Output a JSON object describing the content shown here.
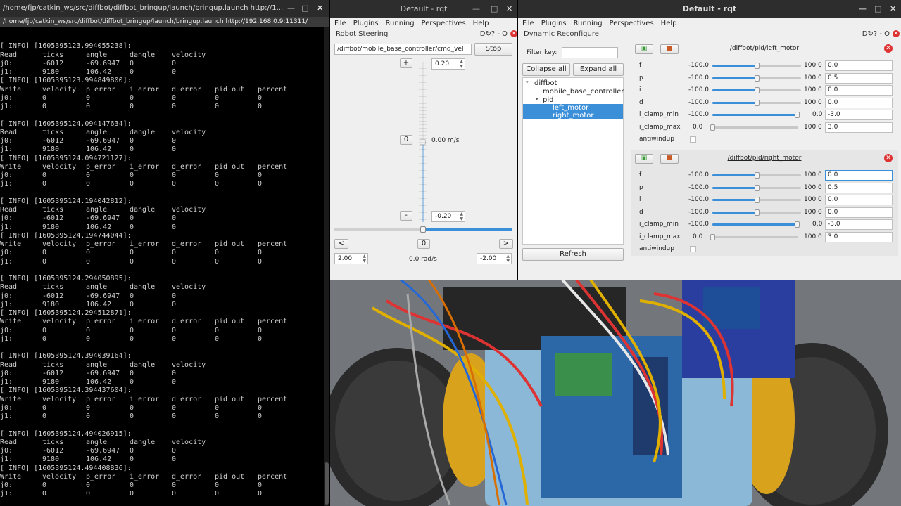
{
  "terminal": {
    "title": "/home/fjp/catkin_ws/src/diffbot/diffbot_bringup/launch/bringup.launch http://1...",
    "tab": "/home/fjp/catkin_ws/src/diffbot/diffbot_bringup/launch/bringup.launch http://192.168.0.9:11311/",
    "lines": [
      [
        ""
      ],
      [
        "[ INFO] [1605395123.994055238]:"
      ],
      [
        "Read",
        "ticks",
        "angle",
        "dangle",
        "velocity"
      ],
      [
        "j0:",
        "-6012",
        "-69.6947",
        "0",
        "0"
      ],
      [
        "j1:",
        "9180",
        "106.42",
        "0",
        "0"
      ],
      [
        "[ INFO] [1605395123.994849800]:"
      ],
      [
        "Write",
        "velocity",
        "p_error",
        "i_error",
        "d_error",
        "pid out",
        "percent"
      ],
      [
        "j0:",
        "0",
        "0",
        "0",
        "0",
        "0",
        "0"
      ],
      [
        "j1:",
        "0",
        "0",
        "0",
        "0",
        "0",
        "0"
      ],
      [
        ""
      ],
      [
        "[ INFO] [1605395124.094147634]:"
      ],
      [
        "Read",
        "ticks",
        "angle",
        "dangle",
        "velocity"
      ],
      [
        "j0:",
        "-6012",
        "-69.6947",
        "0",
        "0"
      ],
      [
        "j1:",
        "9180",
        "106.42",
        "0",
        "0"
      ],
      [
        "[ INFO] [1605395124.094721127]:"
      ],
      [
        "Write",
        "velocity",
        "p_error",
        "i_error",
        "d_error",
        "pid out",
        "percent"
      ],
      [
        "j0:",
        "0",
        "0",
        "0",
        "0",
        "0",
        "0"
      ],
      [
        "j1:",
        "0",
        "0",
        "0",
        "0",
        "0",
        "0"
      ],
      [
        ""
      ],
      [
        "[ INFO] [1605395124.194042812]:"
      ],
      [
        "Read",
        "ticks",
        "angle",
        "dangle",
        "velocity"
      ],
      [
        "j0:",
        "-6012",
        "-69.6947",
        "0",
        "0"
      ],
      [
        "j1:",
        "9180",
        "106.42",
        "0",
        "0"
      ],
      [
        "[ INFO] [1605395124.194744044]:"
      ],
      [
        "Write",
        "velocity",
        "p_error",
        "i_error",
        "d_error",
        "pid out",
        "percent"
      ],
      [
        "j0:",
        "0",
        "0",
        "0",
        "0",
        "0",
        "0"
      ],
      [
        "j1:",
        "0",
        "0",
        "0",
        "0",
        "0",
        "0"
      ],
      [
        ""
      ],
      [
        "[ INFO] [1605395124.294050895]:"
      ],
      [
        "Read",
        "ticks",
        "angle",
        "dangle",
        "velocity"
      ],
      [
        "j0:",
        "-6012",
        "-69.6947",
        "0",
        "0"
      ],
      [
        "j1:",
        "9180",
        "106.42",
        "0",
        "0"
      ],
      [
        "[ INFO] [1605395124.294512871]:"
      ],
      [
        "Write",
        "velocity",
        "p_error",
        "i_error",
        "d_error",
        "pid out",
        "percent"
      ],
      [
        "j0:",
        "0",
        "0",
        "0",
        "0",
        "0",
        "0"
      ],
      [
        "j1:",
        "0",
        "0",
        "0",
        "0",
        "0",
        "0"
      ],
      [
        ""
      ],
      [
        "[ INFO] [1605395124.394039164]:"
      ],
      [
        "Read",
        "ticks",
        "angle",
        "dangle",
        "velocity"
      ],
      [
        "j0:",
        "-6012",
        "-69.6947",
        "0",
        "0"
      ],
      [
        "j1:",
        "9180",
        "106.42",
        "0",
        "0"
      ],
      [
        "[ INFO] [1605395124.394437604]:"
      ],
      [
        "Write",
        "velocity",
        "p_error",
        "i_error",
        "d_error",
        "pid out",
        "percent"
      ],
      [
        "j0:",
        "0",
        "0",
        "0",
        "0",
        "0",
        "0"
      ],
      [
        "j1:",
        "0",
        "0",
        "0",
        "0",
        "0",
        "0"
      ],
      [
        ""
      ],
      [
        "[ INFO] [1605395124.494026915]:"
      ],
      [
        "Read",
        "ticks",
        "angle",
        "dangle",
        "velocity"
      ],
      [
        "j0:",
        "-6012",
        "-69.6947",
        "0",
        "0"
      ],
      [
        "j1:",
        "9180",
        "106.42",
        "0",
        "0"
      ],
      [
        "[ INFO] [1605395124.494408836]:"
      ],
      [
        "Write",
        "velocity",
        "p_error",
        "i_error",
        "d_error",
        "pid out",
        "percent"
      ],
      [
        "j0:",
        "0",
        "0",
        "0",
        "0",
        "0",
        "0"
      ],
      [
        "j1:",
        "0",
        "0",
        "0",
        "0",
        "0",
        "0"
      ]
    ]
  },
  "rqt1": {
    "title": "Default - rqt",
    "menu": [
      "File",
      "Plugins",
      "Running",
      "Perspectives",
      "Help"
    ],
    "plugin": "Robot Steering",
    "plugin_ctrls": "D↻? - O",
    "topic": "/diffbot/mobile_base_controller/cmd_vel",
    "stop": "Stop",
    "plus": "+",
    "minus": "-",
    "zero_v": "0",
    "v_max": "0.20",
    "v_min": "-0.20",
    "v_readout": "0.00 m/s",
    "left": "<",
    "right": ">",
    "zero_w": "0",
    "w_max": "2.00",
    "w_min": "-2.00",
    "w_readout": "0.0 rad/s",
    "linear_level": 0.5,
    "angular_level": 0.5
  },
  "rqt2": {
    "title": "Default - rqt",
    "menu": [
      "File",
      "Plugins",
      "Running",
      "Perspectives",
      "Help"
    ],
    "plugin": "Dynamic Reconfigure",
    "plugin_ctrls": "D↻? - O",
    "filter_label": "Filter key:",
    "filter_value": "",
    "collapse": "Collapse all",
    "expand": "Expand all",
    "tree": [
      "diffbot",
      "mobile_base_controller",
      "pid",
      "left_motor",
      "right_motor"
    ],
    "refresh": "Refresh",
    "groups": [
      {
        "name": "/diffbot/pid/left_motor",
        "params": [
          {
            "label": "f",
            "min": "-100.0",
            "max": "100.0",
            "value": "0.0",
            "level": 0.5
          },
          {
            "label": "p",
            "min": "-100.0",
            "max": "100.0",
            "value": "0.5",
            "level": 0.5
          },
          {
            "label": "i",
            "min": "-100.0",
            "max": "100.0",
            "value": "0.0",
            "level": 0.5
          },
          {
            "label": "d",
            "min": "-100.0",
            "max": "100.0",
            "value": "0.0",
            "level": 0.5
          },
          {
            "label": "i_clamp_min",
            "min": "-100.0",
            "max": "0.0",
            "value": "-3.0",
            "level": 0.97
          },
          {
            "label": "i_clamp_max",
            "min": "0.0",
            "max": "100.0",
            "value": "3.0",
            "level": 0.03
          }
        ],
        "antiwindup": "antiwindup"
      },
      {
        "name": "/diffbot/pid/right_motor",
        "params": [
          {
            "label": "f",
            "min": "-100.0",
            "max": "100.0",
            "value": "0.0",
            "level": 0.5
          },
          {
            "label": "p",
            "min": "-100.0",
            "max": "100.0",
            "value": "0.5",
            "level": 0.5
          },
          {
            "label": "i",
            "min": "-100.0",
            "max": "100.0",
            "value": "0.0",
            "level": 0.5
          },
          {
            "label": "d",
            "min": "-100.0",
            "max": "100.0",
            "value": "0.0",
            "level": 0.5
          },
          {
            "label": "i_clamp_min",
            "min": "-100.0",
            "max": "0.0",
            "value": "-3.0",
            "level": 0.97
          },
          {
            "label": "i_clamp_max",
            "min": "0.0",
            "max": "100.0",
            "value": "3.0",
            "level": 0.03
          }
        ],
        "antiwindup": "antiwindup"
      }
    ]
  },
  "colors": {
    "accent": "#3b8fd9",
    "close": "#dd3333"
  }
}
